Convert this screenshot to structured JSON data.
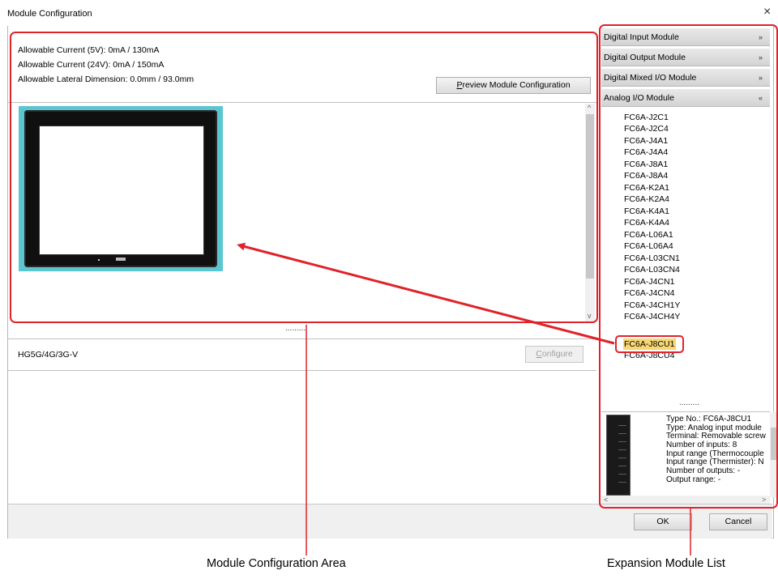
{
  "window": {
    "title": "Module Configuration",
    "close_glyph": "×"
  },
  "info": {
    "current_5v": "Allowable Current (5V): 0mA / 130mA",
    "current_24v": "Allowable Current (24V): 0mA / 150mA",
    "lateral_dimension": "Allowable Lateral Dimension: 0.0mm / 93.0mm"
  },
  "buttons": {
    "preview_prefix": "P",
    "preview_rest": "review Module Configuration",
    "configure_prefix": "C",
    "configure_rest": "onfigure",
    "ok": "OK",
    "cancel": "Cancel"
  },
  "model": {
    "name": "HG5G/4G/3G-V"
  },
  "splitter": {
    "dots": "........."
  },
  "categories": [
    {
      "label": "Digital Input Module",
      "expanded": false,
      "chevron": "»"
    },
    {
      "label": "Digital Output Module",
      "expanded": false,
      "chevron": "»"
    },
    {
      "label": "Digital Mixed I/O Module",
      "expanded": false,
      "chevron": "»"
    },
    {
      "label": "Analog I/O Module",
      "expanded": true,
      "chevron": "«"
    }
  ],
  "modules": [
    "FC6A-J2C1",
    "FC6A-J2C4",
    "FC6A-J4A1",
    "FC6A-J4A4",
    "FC6A-J8A1",
    "FC6A-J8A4",
    "FC6A-K2A1",
    "FC6A-K2A4",
    "FC6A-K4A1",
    "FC6A-K4A4",
    "FC6A-L06A1",
    "FC6A-L06A4",
    "FC6A-L03CN1",
    "FC6A-L03CN4",
    "FC6A-J4CN1",
    "FC6A-J4CN4",
    "FC6A-J4CH1Y",
    "FC6A-J4CH4Y",
    "FC6A-J8CU1",
    "FC6A-J8CU4"
  ],
  "selected_module": "FC6A-J8CU1",
  "details": [
    "Type No.: FC6A-J8CU1",
    "Type: Analog input module",
    "Terminal: Removable screw",
    "Number of inputs: 8",
    "Input range (Thermocouple",
    "Input range (Thermister): N",
    "Number of outputs: -",
    "Output range: -"
  ],
  "annotations": {
    "config_area": "Module Configuration Area",
    "module_list": "Expansion Module List",
    "color": "#e0222a"
  },
  "icons": {
    "scroll_up": "^",
    "scroll_down": "v",
    "scroll_left": "<",
    "scroll_right": ">"
  }
}
